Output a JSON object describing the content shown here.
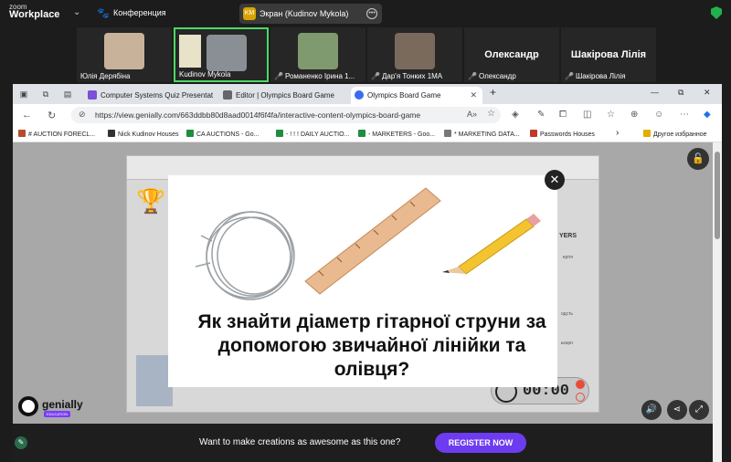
{
  "zoom": {
    "logo_small": "zoom",
    "logo_big": "Workplace",
    "conference_label": "Конференция",
    "share_badge": "KM",
    "share_label": "Экран (Kudinov Mykola)",
    "participants": [
      {
        "name": "Юлія Дерябіна",
        "muted": false
      },
      {
        "name": "Kudinov Mykola",
        "muted": false
      },
      {
        "name": "Романенко Ірина 1...",
        "muted": true
      },
      {
        "name": "Дар'я Тонких 1МА",
        "muted": true
      },
      {
        "name": "Олександр",
        "muted": true,
        "display": "Олександр"
      },
      {
        "name": "Шакірова Лілія",
        "muted": true,
        "display": "Шакірова Лілія"
      }
    ]
  },
  "browser": {
    "tabs": [
      {
        "label": "Computer Systems Quiz Presentat",
        "color": "#7b4fd6"
      },
      {
        "label": "Editor | Olympics Board Game",
        "color": "#555555"
      },
      {
        "label": "Olympics Board Game",
        "color": "#3b6cf0"
      }
    ],
    "new_tab": "+",
    "url": "https://view.genially.com/663ddbb80d8aad0014f6f4fa/interactive-content-olympics-board-game",
    "bookmarks": [
      {
        "label": "# AUCTION FORECL...",
        "color": "#b94a2c"
      },
      {
        "label": "Nick Kudinov Houses",
        "color": "#333333"
      },
      {
        "label": "CA AUCTIONS - Go...",
        "color": "#1e8e3e"
      },
      {
        "label": "- ! ! ! DAILY AUCTIO...",
        "color": "#1e8e3e"
      },
      {
        "label": "- MARKETERS - Goo...",
        "color": "#1e8e3e"
      },
      {
        "label": "* MARKETING DATA...",
        "color": "#555555"
      },
      {
        "label": "Passwords Houses",
        "color": "#c0392b"
      },
      {
        "label": "Другое избранное",
        "color": "#e0b000"
      }
    ]
  },
  "genially": {
    "players_label": "YERS",
    "side_labels": [
      "ергія",
      "одсть",
      "ькарн"
    ],
    "timer": "00:00",
    "question": "Як знайти діаметр гітарної струни за допомогою звичайної лінійки та олівця?",
    "logo_text": "genially",
    "logo_edu": "EDUCATION",
    "footer_text": "Want to make creations as awesome as this one?",
    "register_label": "REGISTER NOW",
    "close_symbol": "✕"
  },
  "colors": {
    "accent_purple": "#6d3cf0",
    "zoom_active_border": "#4cd964",
    "muted_mic": "#e23b3b"
  }
}
